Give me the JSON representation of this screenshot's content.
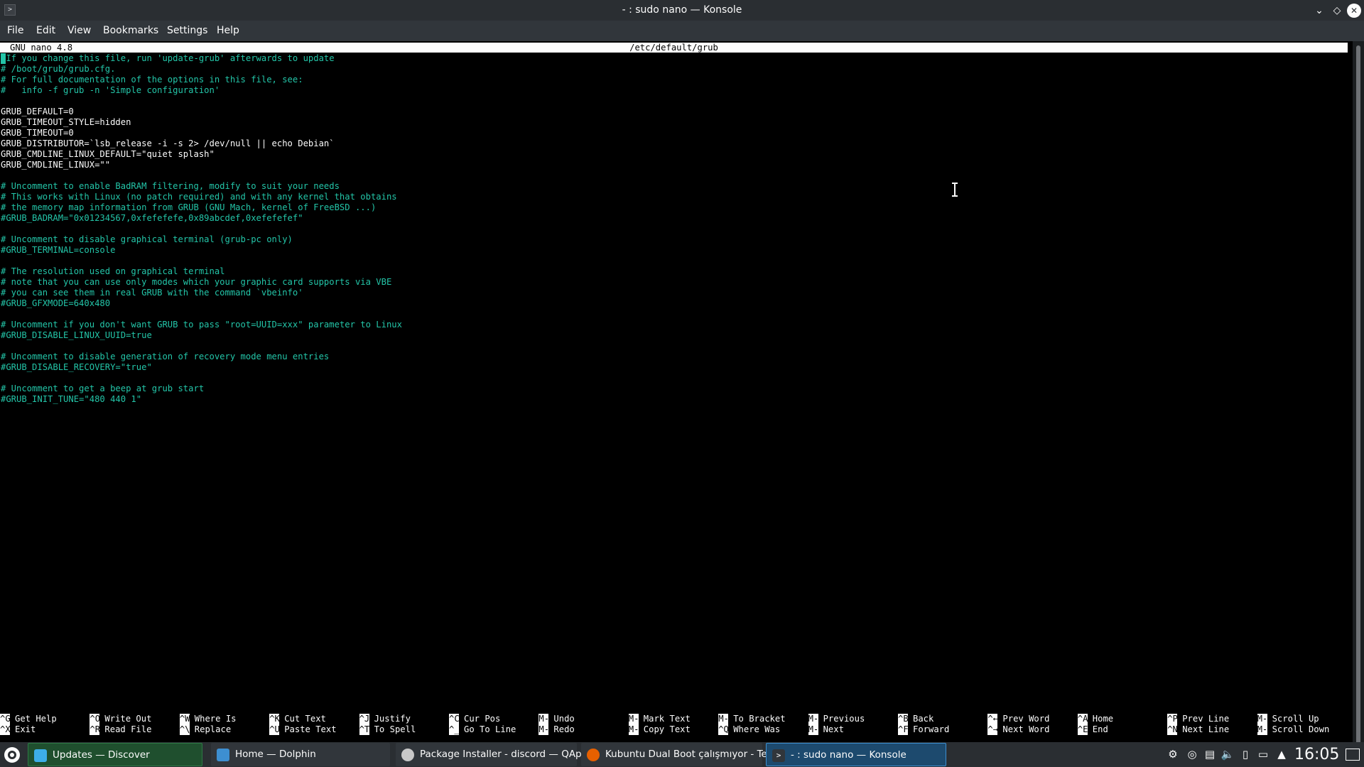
{
  "window": {
    "title": "- : sudo nano — Konsole",
    "app_icon": "terminal-icon"
  },
  "menubar": {
    "items": [
      "File",
      "Edit",
      "View",
      "Bookmarks",
      "Settings",
      "Help"
    ]
  },
  "nano": {
    "version": "GNU nano 4.8",
    "filename": "/etc/default/grub",
    "lines": [
      {
        "text": " If you change this file, run 'update-grub' afterwards to update",
        "kind": "comment"
      },
      {
        "text": "# /boot/grub/grub.cfg.",
        "kind": "comment"
      },
      {
        "text": "# For full documentation of the options in this file, see:",
        "kind": "comment"
      },
      {
        "text": "#   info -f grub -n 'Simple configuration'",
        "kind": "comment"
      },
      {
        "text": "",
        "kind": "plain"
      },
      {
        "text": "GRUB_DEFAULT=0",
        "kind": "plain"
      },
      {
        "text": "GRUB_TIMEOUT_STYLE=hidden",
        "kind": "plain"
      },
      {
        "text": "GRUB_TIMEOUT=0",
        "kind": "plain"
      },
      {
        "text": "GRUB_DISTRIBUTOR=`lsb_release -i -s 2> /dev/null || echo Debian`",
        "kind": "plain"
      },
      {
        "text": "GRUB_CMDLINE_LINUX_DEFAULT=\"quiet splash\"",
        "kind": "plain"
      },
      {
        "text": "GRUB_CMDLINE_LINUX=\"\"",
        "kind": "plain"
      },
      {
        "text": "",
        "kind": "plain"
      },
      {
        "text": "# Uncomment to enable BadRAM filtering, modify to suit your needs",
        "kind": "comment"
      },
      {
        "text": "# This works with Linux (no patch required) and with any kernel that obtains",
        "kind": "comment"
      },
      {
        "text": "# the memory map information from GRUB (GNU Mach, kernel of FreeBSD ...)",
        "kind": "comment"
      },
      {
        "text": "#GRUB_BADRAM=\"0x01234567,0xfefefefe,0x89abcdef,0xefefefef\"",
        "kind": "comment"
      },
      {
        "text": "",
        "kind": "plain"
      },
      {
        "text": "# Uncomment to disable graphical terminal (grub-pc only)",
        "kind": "comment"
      },
      {
        "text": "#GRUB_TERMINAL=console",
        "kind": "comment"
      },
      {
        "text": "",
        "kind": "plain"
      },
      {
        "text": "# The resolution used on graphical terminal",
        "kind": "comment"
      },
      {
        "text": "# note that you can use only modes which your graphic card supports via VBE",
        "kind": "comment"
      },
      {
        "text": "# you can see them in real GRUB with the command `vbeinfo'",
        "kind": "comment"
      },
      {
        "text": "#GRUB_GFXMODE=640x480",
        "kind": "comment"
      },
      {
        "text": "",
        "kind": "plain"
      },
      {
        "text": "# Uncomment if you don't want GRUB to pass \"root=UUID=xxx\" parameter to Linux",
        "kind": "comment"
      },
      {
        "text": "#GRUB_DISABLE_LINUX_UUID=true",
        "kind": "comment"
      },
      {
        "text": "",
        "kind": "plain"
      },
      {
        "text": "# Uncomment to disable generation of recovery mode menu entries",
        "kind": "comment"
      },
      {
        "text": "#GRUB_DISABLE_RECOVERY=\"true\"",
        "kind": "comment"
      },
      {
        "text": "",
        "kind": "plain"
      },
      {
        "text": "# Uncomment to get a beep at grub start",
        "kind": "comment"
      },
      {
        "text": "#GRUB_INIT_TUNE=\"480 440 1\"",
        "kind": "comment"
      }
    ],
    "shortcuts": [
      {
        "key": "^G",
        "label": "Get Help"
      },
      {
        "key": "^X",
        "label": "Exit"
      },
      {
        "key": "^O",
        "label": "Write Out"
      },
      {
        "key": "^R",
        "label": "Read File"
      },
      {
        "key": "^W",
        "label": "Where Is"
      },
      {
        "key": "^\\",
        "label": "Replace"
      },
      {
        "key": "^K",
        "label": "Cut Text"
      },
      {
        "key": "^U",
        "label": "Paste Text"
      },
      {
        "key": "^J",
        "label": "Justify"
      },
      {
        "key": "^T",
        "label": "To Spell"
      },
      {
        "key": "^C",
        "label": "Cur Pos"
      },
      {
        "key": "^_",
        "label": "Go To Line"
      },
      {
        "key": "M-U",
        "label": "Undo"
      },
      {
        "key": "M-E",
        "label": "Redo"
      },
      {
        "key": "M-A",
        "label": "Mark Text"
      },
      {
        "key": "M-6",
        "label": "Copy Text"
      },
      {
        "key": "M-]",
        "label": "To Bracket"
      },
      {
        "key": "^Q",
        "label": "Where Was"
      },
      {
        "key": "M-Q",
        "label": "Previous"
      },
      {
        "key": "M-W",
        "label": "Next"
      },
      {
        "key": "^B",
        "label": "Back"
      },
      {
        "key": "^F",
        "label": "Forward"
      },
      {
        "key": "^←",
        "label": "Prev Word"
      },
      {
        "key": "^→",
        "label": "Next Word"
      },
      {
        "key": "^A",
        "label": "Home"
      },
      {
        "key": "^E",
        "label": "End"
      },
      {
        "key": "^P",
        "label": "Prev Line"
      },
      {
        "key": "^N",
        "label": "Next Line"
      },
      {
        "key": "M-▲",
        "label": "Scroll Up"
      },
      {
        "key": "M-▼",
        "label": "Scroll Down"
      }
    ]
  },
  "taskbar": {
    "launcher_icon": "kde-launcher-icon",
    "tasks": [
      {
        "label": "Updates — Discover",
        "icon": "discover-icon",
        "color": "#1f4f2e"
      },
      {
        "label": "Home — Dolphin",
        "icon": "dolphin-folder-icon",
        "color": "#31363b"
      },
      {
        "label": "Package Installer - discord — QApt...",
        "icon": "package-icon",
        "color": "#31363b"
      },
      {
        "label": "Kubuntu Dual Boot çalışmıyor - Te...",
        "icon": "firefox-icon",
        "color": "#31363b"
      },
      {
        "label": "- : sudo nano — Konsole",
        "icon": "konsole-icon",
        "color": "#1d4a6e"
      }
    ],
    "tray_icons": [
      "network-settings-icon",
      "update-notifier-icon",
      "clipboard-icon",
      "volume-icon",
      "battery-icon",
      "display-icon",
      "expand-tray-arrow-icon"
    ],
    "clock": "16:05",
    "show_desktop_icon": "show-desktop-icon"
  },
  "colors": {
    "comment": "#23c5a8",
    "text": "#fcfcfc",
    "background": "#000000",
    "titlebar": "#2a2e32",
    "menubar": "#31363b",
    "active_task_border": "#3d8fd1"
  }
}
